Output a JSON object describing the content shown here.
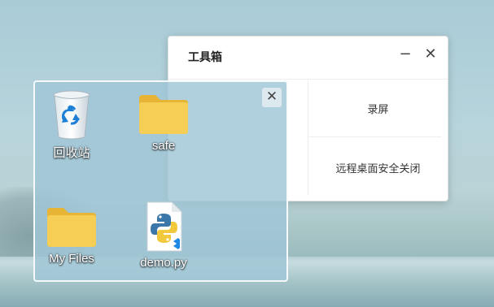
{
  "toolbox": {
    "title": "工具箱",
    "minimize_glyph": "−",
    "close_glyph": "✕",
    "items": {
      "record": "录屏",
      "remote_close": "远程桌面安全关闭"
    }
  },
  "folder_popup": {
    "close_glyph": "✕",
    "icons": [
      {
        "label": "回收站",
        "icon": "recycle-bin-icon"
      },
      {
        "label": "safe",
        "icon": "folder-icon"
      },
      {
        "label": "My Files",
        "icon": "folder-icon"
      },
      {
        "label": "demo.py",
        "icon": "python-file-icon"
      }
    ]
  },
  "colors": {
    "folder": "#f5c94c",
    "recycle": "#1e7fd6",
    "python_blue": "#3b77a8",
    "python_yellow": "#f2c83c"
  }
}
